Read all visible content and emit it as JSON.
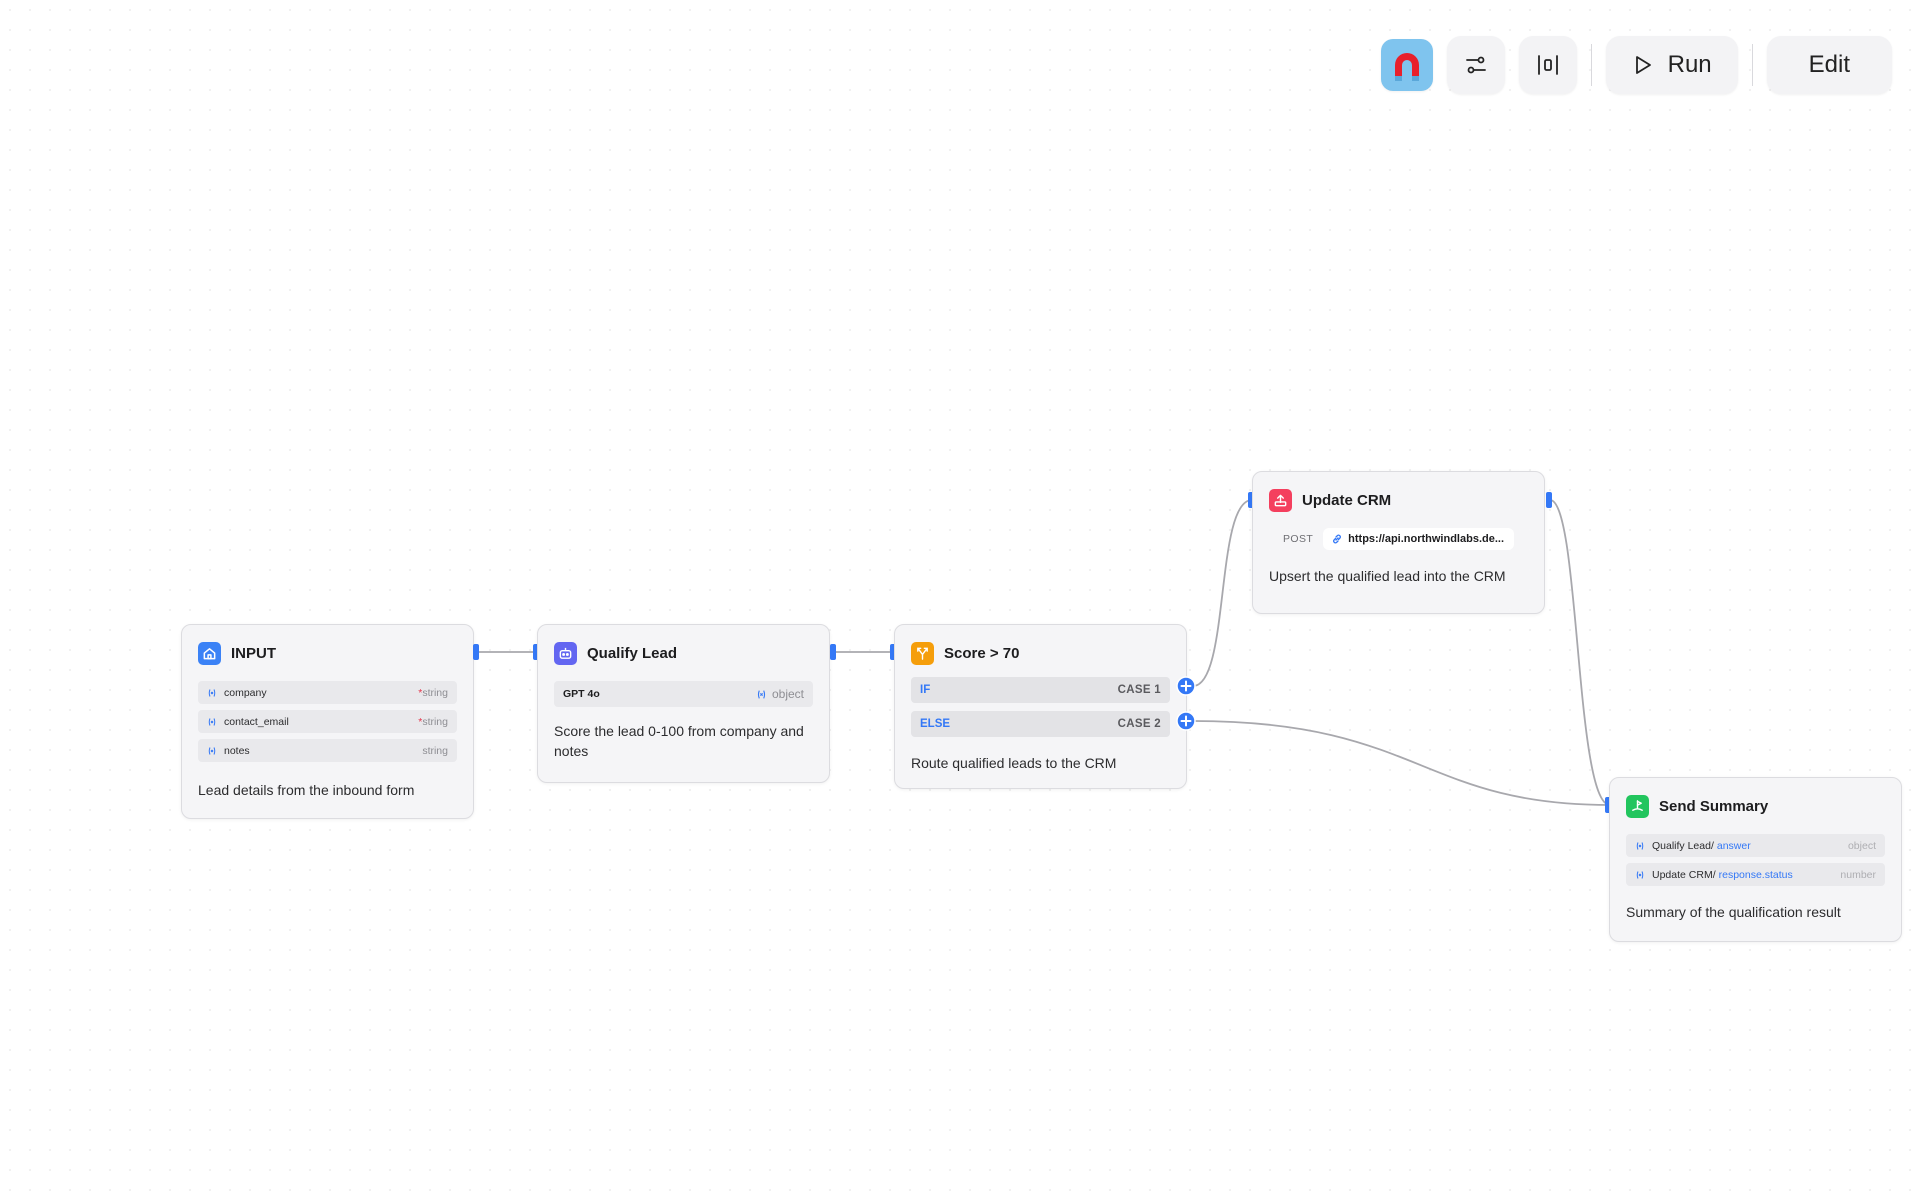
{
  "toolbar": {
    "run_label": "Run",
    "edit_label": "Edit",
    "avatar_color": "#7fc4ee"
  },
  "colors": {
    "handle": "#3478f6",
    "edge": "#a8a8ad",
    "input_icon": "#3b82f6",
    "llm_icon": "#6366f1",
    "condition_icon": "#f59e0b",
    "http_icon": "#f43f5e",
    "end_icon": "#22c55e"
  },
  "nodes": {
    "input": {
      "title": "INPUT",
      "icon": "home-icon",
      "variables": [
        {
          "name": "company",
          "required_mark": "*",
          "type": "string"
        },
        {
          "name": "contact_email",
          "required_mark": "*",
          "type": "string"
        },
        {
          "name": "notes",
          "required_mark": "",
          "type": "string"
        }
      ],
      "description": "Lead details from the inbound form"
    },
    "qualify": {
      "title": "Qualify Lead",
      "icon": "robot-icon",
      "model": "GPT 4o",
      "output_type": "object",
      "description": "Score the lead 0-100 from company and notes"
    },
    "condition": {
      "title": "Score > 70",
      "icon": "branch-icon",
      "cases": [
        {
          "key": "IF",
          "label": "CASE 1"
        },
        {
          "key": "ELSE",
          "label": "CASE 2"
        }
      ],
      "description": "Route qualified leads to the CRM"
    },
    "crm": {
      "title": "Update CRM",
      "icon": "upload-icon",
      "method": "POST",
      "url": "https://api.northwindlabs.de...",
      "description": "Upsert the qualified lead into the CRM"
    },
    "summary": {
      "title": "Send Summary",
      "icon": "flag-icon",
      "refs": [
        {
          "source": "Qualify Lead/",
          "field": "answer",
          "type": "object"
        },
        {
          "source": "Update CRM/",
          "field": "response.status",
          "type": "number"
        }
      ],
      "description": "Summary of the qualification result"
    }
  }
}
